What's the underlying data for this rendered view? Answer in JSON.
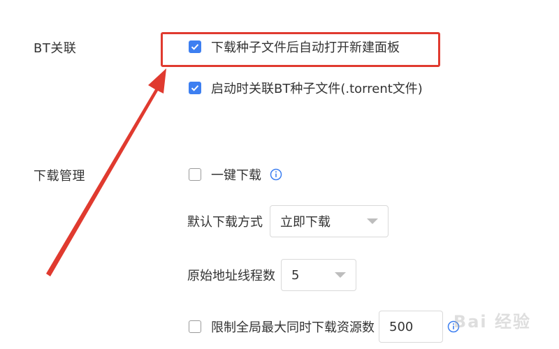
{
  "sections": {
    "bt": {
      "label": "BT关联",
      "options": [
        {
          "label": "下载种子文件后自动打开新建面板",
          "checked": true
        },
        {
          "label": "启动时关联BT种子文件(.torrent文件)",
          "checked": true
        }
      ]
    },
    "download": {
      "label": "下载管理",
      "one_click": {
        "label": "一键下载",
        "checked": false,
        "icon": "info-icon"
      },
      "default_method": {
        "label": "默认下载方式",
        "value": "立即下载"
      },
      "thread_count": {
        "label": "原始地址线程数",
        "value": "5"
      },
      "limit_resources": {
        "label": "限制全局最大同时下载资源数",
        "checked": false,
        "value": "500",
        "icon": "info-icon"
      }
    }
  },
  "annotation": {
    "color": "#e03a2f"
  },
  "accent_color": "#3d7ff1",
  "watermark": "Bai 经验"
}
